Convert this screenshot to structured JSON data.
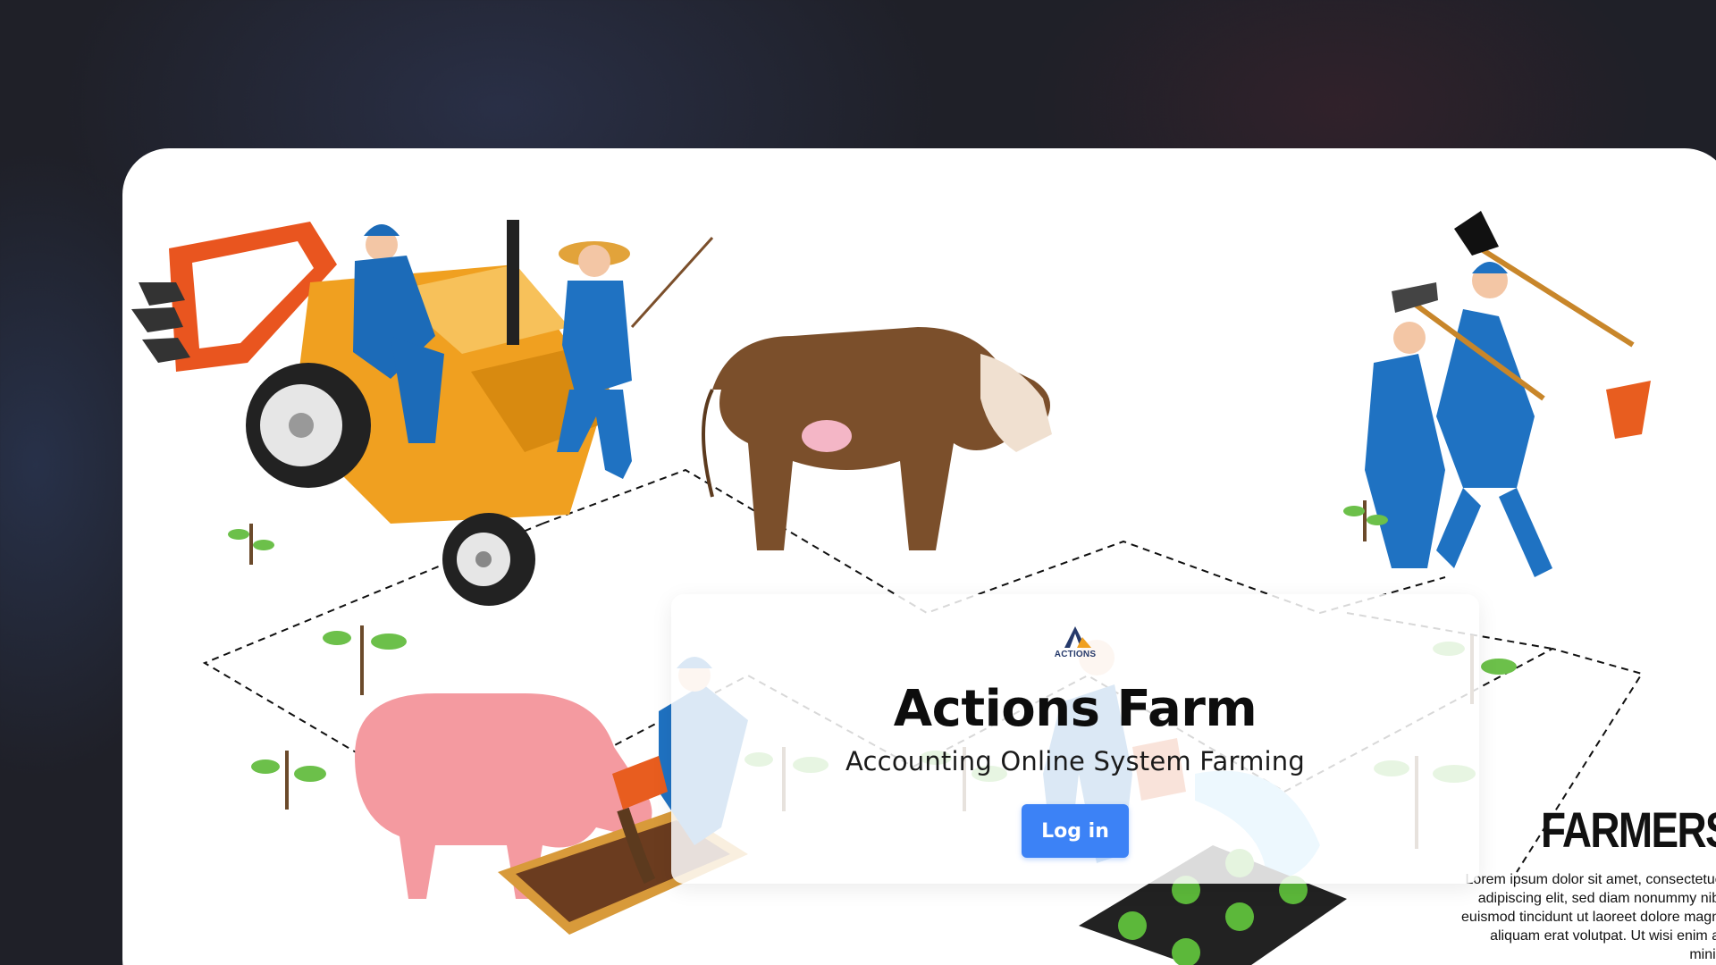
{
  "app": {
    "title": "Actions Farm",
    "subtitle": "Accounting Online System Farming",
    "logo_text": "ACTIONS",
    "login_label": "Log in"
  },
  "illustration": {
    "heading": "FARMERS",
    "body": "Lorem ipsum dolor sit amet, consectetuer adipiscing elit, sed diam nonummy nibh euismod tincidunt ut laoreet dolore magna aliquam erat volutpat. Ut wisi enim ad minim"
  },
  "colors": {
    "background": "#1f2028",
    "button": "#3c82f6",
    "card": "#ffffff"
  },
  "icons": [
    "logo-icon",
    "tractor-illustration",
    "cow-illustration",
    "pig-illustration",
    "watering-illustration",
    "farmers-tools-illustration"
  ]
}
